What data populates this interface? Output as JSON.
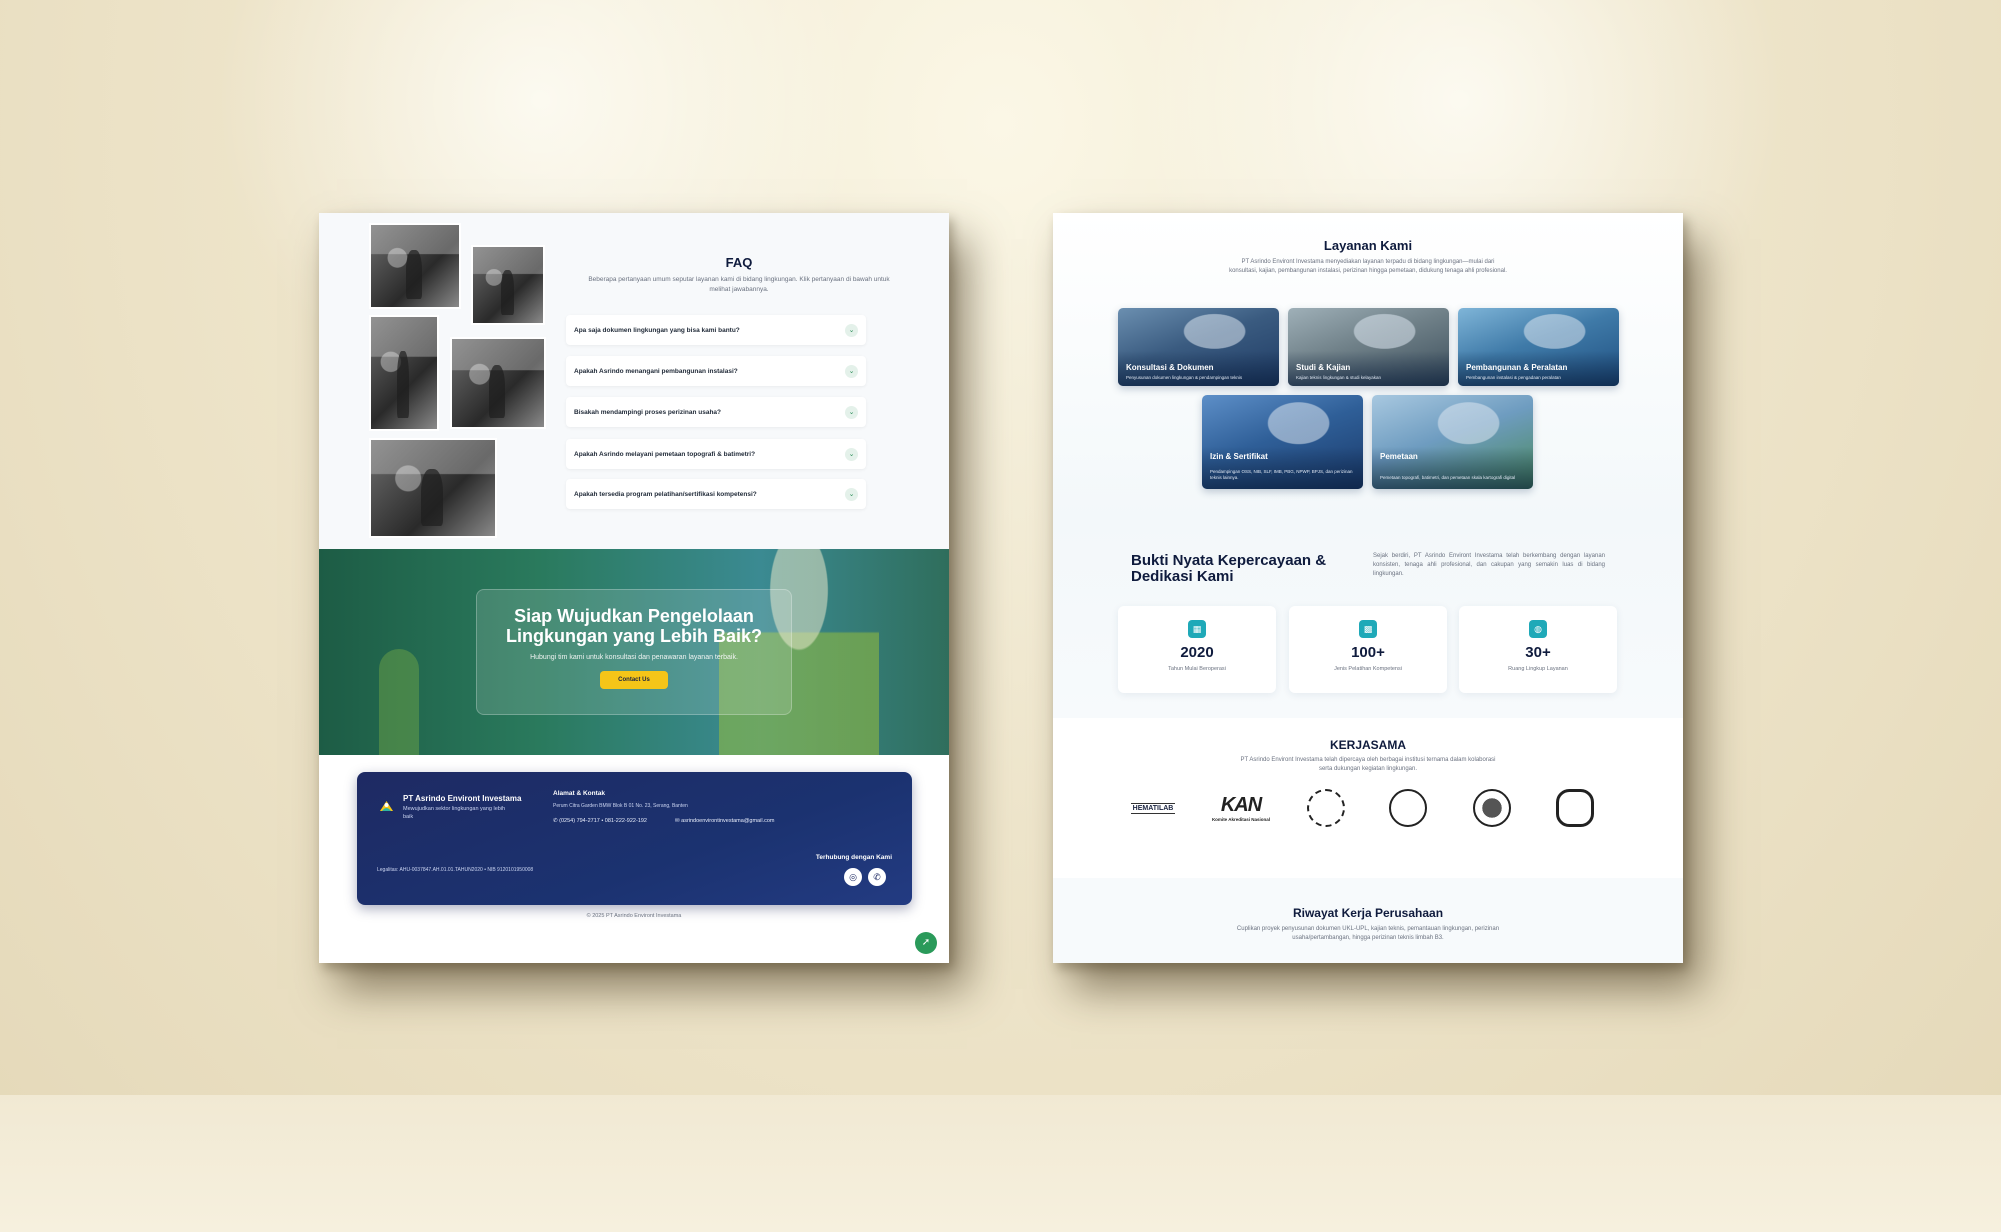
{
  "left_page": {
    "faq": {
      "title": "FAQ",
      "subtitle": "Beberapa pertanyaan umum seputar layanan kami di bidang lingkungan. Klik pertanyaan di bawah untuk melihat jawabannya.",
      "items": [
        {
          "question": "Apa saja dokumen lingkungan yang bisa kami bantu?"
        },
        {
          "question": "Apakah Asrindo menangani pembangunan instalasi?"
        },
        {
          "question": "Bisakah mendampingi proses perizinan usaha?"
        },
        {
          "question": "Apakah Asrindo melayani pemetaan topografi & batimetri?"
        },
        {
          "question": "Apakah tersedia program pelatihan/sertifikasi kompetensi?"
        }
      ],
      "chevron_icon": "chevron-down-icon"
    },
    "cta": {
      "title": "Siap Wujudkan Pengelolaan Lingkungan yang Lebih Baik?",
      "subtitle": "Hubungi tim kami untuk konsultasi dan penawaran layanan terbaik.",
      "button_label": "Contact Us",
      "button_color": "#f5c518"
    },
    "footer": {
      "company": "PT Asrindo Environt Investama",
      "tagline": "Mewujudkan sektor lingkungan yang lebih baik",
      "address_title": "Alamat & Kontak",
      "address": "Perum Citra Garden BMW Blok B 01 No. 23, Serang, Banten",
      "phone": "(0254) 794-2717 • 081-222-922-192",
      "email": "asrindoenvirontinvestama@gmail.com",
      "legal": "Legalitas: AHU-0037847.AH.01.01.TAHUN2020 • NIB 9120101950008",
      "connect_label": "Terhubung dengan Kami",
      "social_icons": [
        "instagram-icon",
        "whatsapp-icon"
      ],
      "copyright": "© 2025 PT Asrindo Environt Investama"
    },
    "fab_icon": "rocket-icon"
  },
  "right_page": {
    "services": {
      "title": "Layanan Kami",
      "subtitle": "PT Asrindo Environt Investama menyediakan layanan terpadu di bidang lingkungan—mulai dari konsultasi, kajian, pembangunan instalasi, perizinan hingga pemetaan, didukung tenaga ahli profesional.",
      "cards": [
        {
          "name": "Konsultasi & Dokumen",
          "desc": "Penyusunan dokumen lingkungan & pendampingan teknis"
        },
        {
          "name": "Studi & Kajian",
          "desc": "Kajian teknis lingkungan & studi kelayakan"
        },
        {
          "name": "Pembangunan & Peralatan",
          "desc": "Pembangunan instalasi & pengadaan peralatan"
        },
        {
          "name": "Izin & Sertifikat",
          "desc": "Pendampingan OSS, NIB, SLF, IMB, PBG, NPWP, BPJS, dan perizinan teknis lainnya."
        },
        {
          "name": "Pemetaan",
          "desc": "Pemetaan topografi, batimetri, dan pemetaan skala kartografi digital"
        }
      ]
    },
    "proof": {
      "title": "Bukti Nyata Kepercayaan & Dedikasi Kami",
      "text": "Sejak berdiri, PT Asrindo Environt Investama telah berkembang dengan layanan konsisten, tenaga ahli profesional, dan cakupan yang semakin luas di bidang lingkungan.",
      "stats": [
        {
          "value": "2020",
          "label": "Tahun Mulai Beroperasi",
          "icon": "calendar-icon",
          "color": "#1fa9b8"
        },
        {
          "value": "100+",
          "label": "Jenis Pelatihan Kompetensi",
          "icon": "grid-icon",
          "color": "#1fa9b8"
        },
        {
          "value": "30+",
          "label": "Ruang Lingkup Layanan",
          "icon": "globe-icon",
          "color": "#1fa9b8"
        }
      ]
    },
    "partners": {
      "title": "KERJASAMA",
      "subtitle": "PT Asrindo Environt Investama telah dipercaya oleh berbagai institusi ternama dalam kolaborasi serta dukungan kegiatan lingkungan.",
      "logos": [
        {
          "name": "HEMATILAB",
          "kind": "text"
        },
        {
          "name": "KAN",
          "sub": "Komite Akreditasi Nasional",
          "kind": "kan"
        },
        {
          "name": "",
          "kind": "circle"
        },
        {
          "name": "",
          "kind": "circle"
        },
        {
          "name": "",
          "kind": "circle"
        },
        {
          "name": "",
          "kind": "circle"
        }
      ]
    },
    "history": {
      "title": "Riwayat Kerja Perusahaan",
      "subtitle": "Cuplikan proyek penyusunan dokumen UKL-UPL, kajian teknis, pemantauan lingkungan, perizinan usaha/pertambangan, hingga perizinan teknis limbah B3."
    }
  }
}
